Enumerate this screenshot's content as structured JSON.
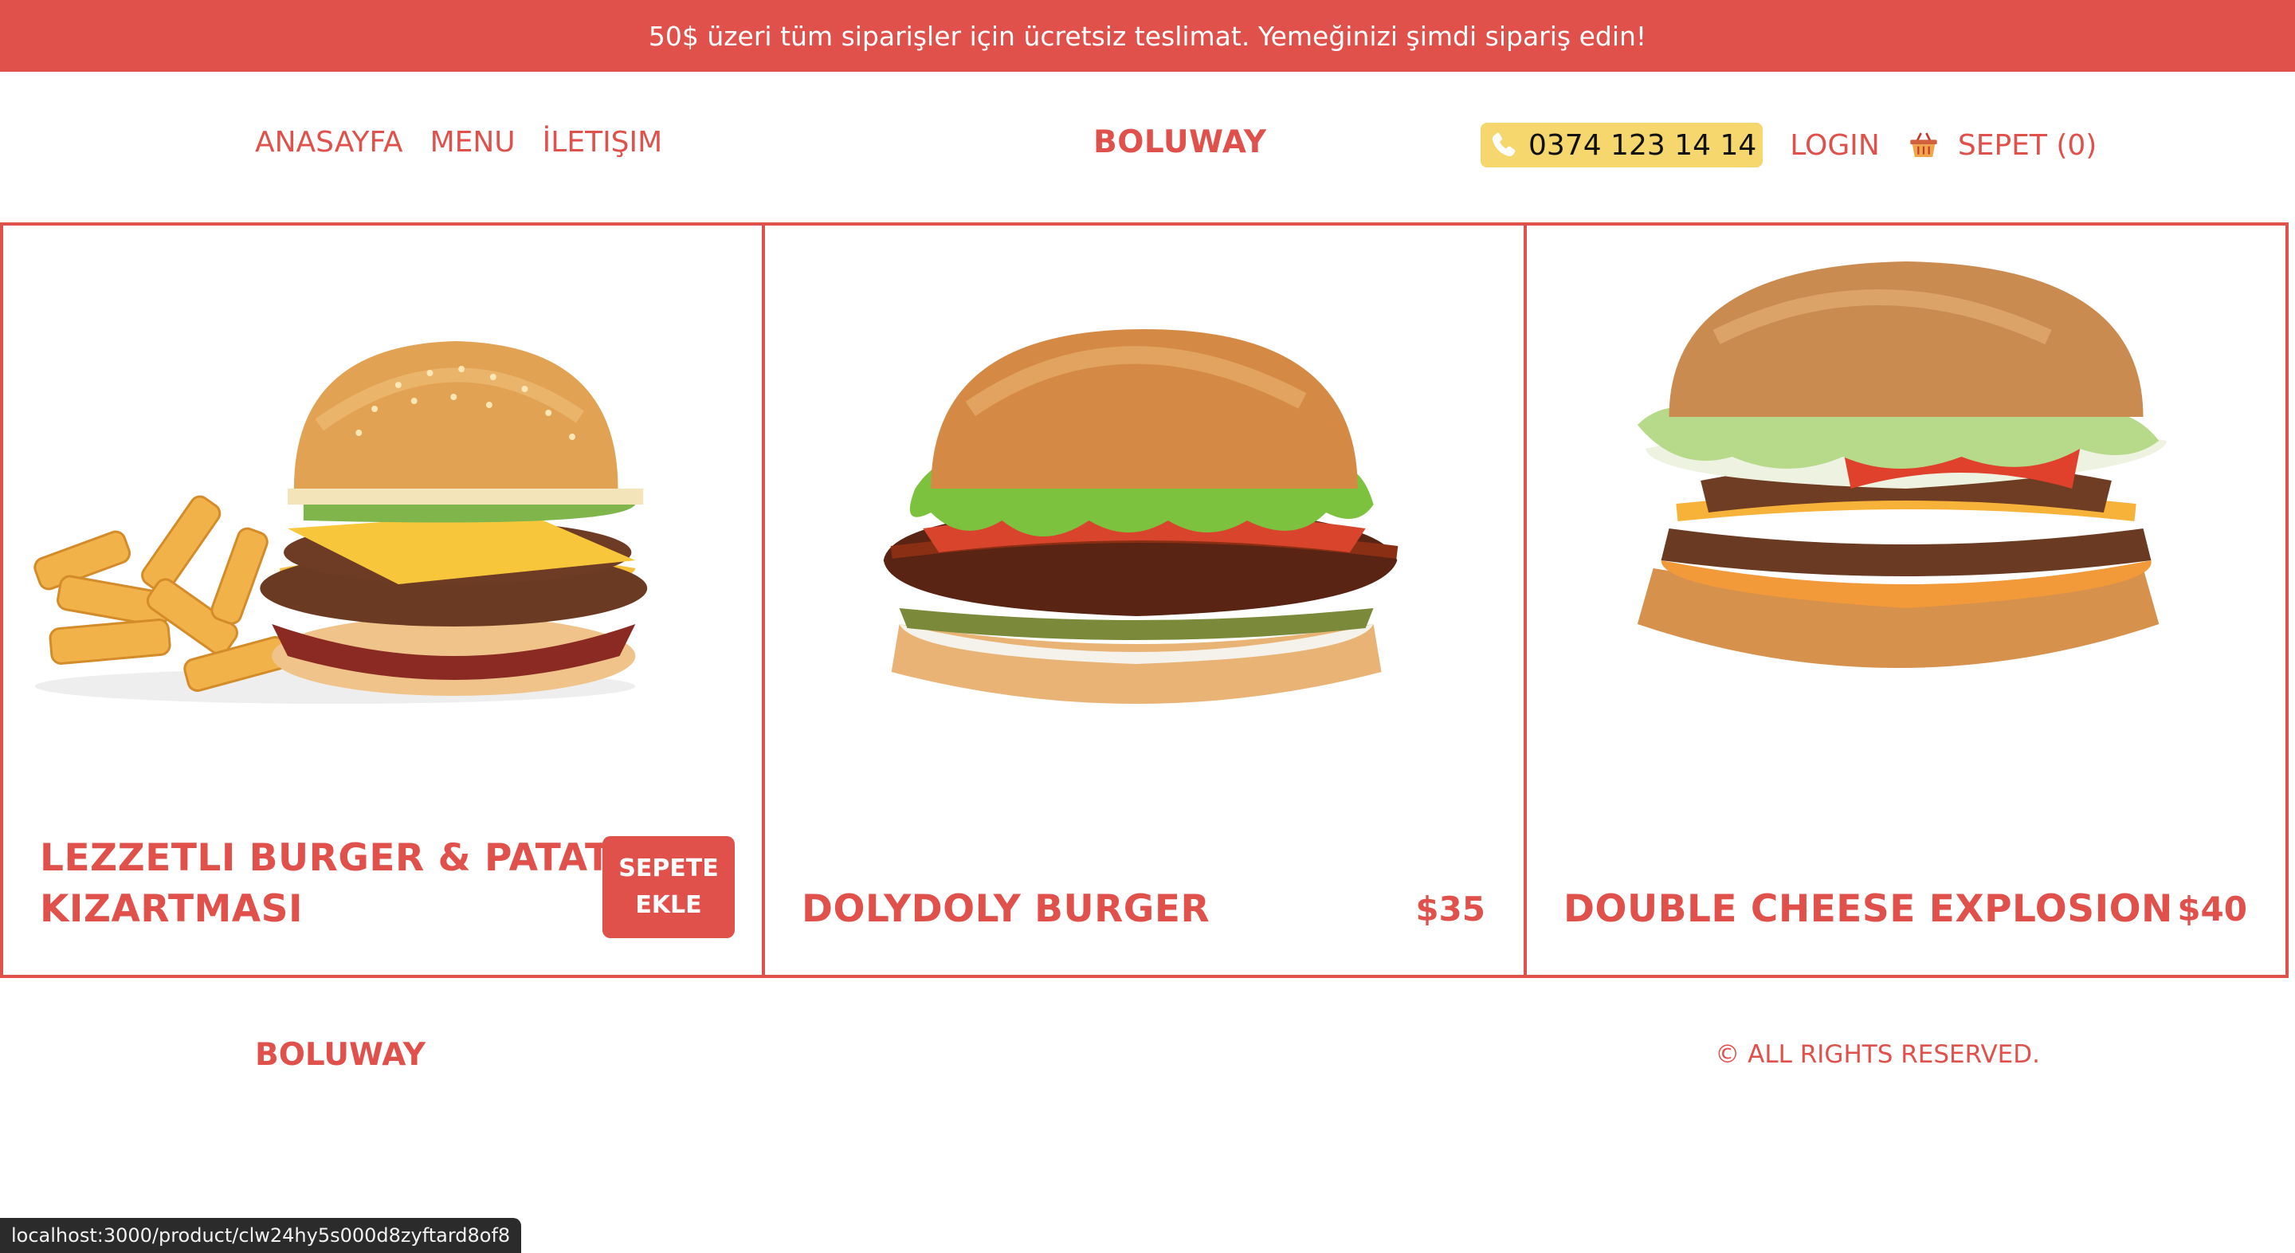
{
  "promo": {
    "text": "50$ üzeri tüm siparişler için ücretsiz teslimat. Yemeğinizi şimdi sipariş edin!"
  },
  "nav": {
    "home": "ANASAYFA",
    "menu": "MENU",
    "contact": "İLETIŞIM"
  },
  "brand": "BOLUWAY",
  "header_right": {
    "phone": "0374 123 14 14",
    "login": "LOGIN",
    "cart": "SEPET (0)"
  },
  "products": [
    {
      "title_line1": "LEZZETLI BURGER & PATATES",
      "title_line2": "KIZARTMASI",
      "button_line1": "SEPETE",
      "button_line2": "EKLE"
    },
    {
      "title": "DOLYDOLY BURGER",
      "price": "$35"
    },
    {
      "title": "DOUBLE CHEESE EXPLOSION",
      "price": "$40"
    }
  ],
  "footer": {
    "brand": "BOLUWAY",
    "copyright": "© ALL RIGHTS RESERVED."
  },
  "status_bar": {
    "url": "localhost:3000/product/clw24hy5s000d8zyftard8of8"
  },
  "colors": {
    "accent": "#e0514c",
    "phone_bg": "#f5d76e"
  }
}
